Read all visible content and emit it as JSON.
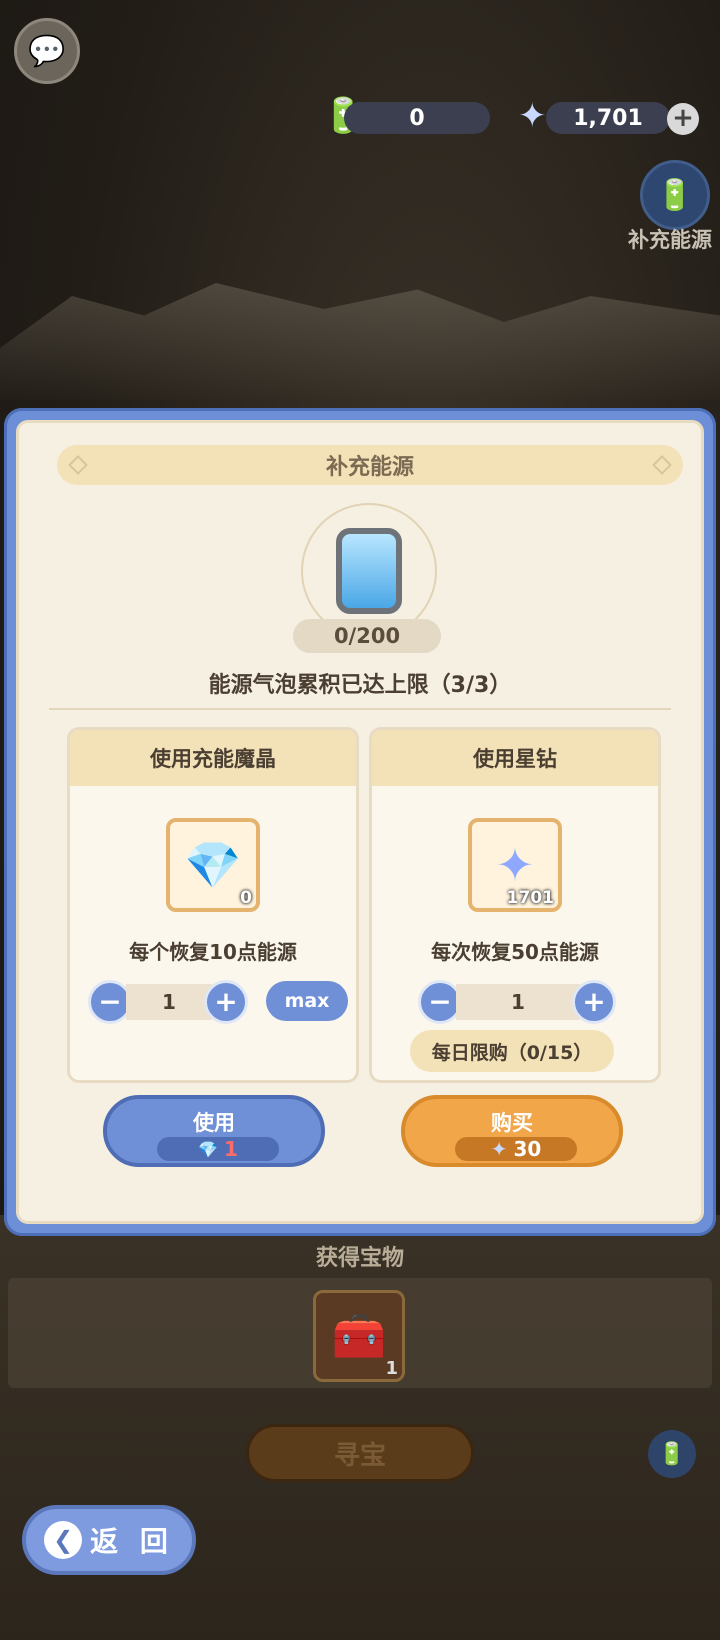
{
  "hud": {
    "energy_capsules": "0",
    "star_diamonds": "1,701",
    "add_icon": "+",
    "side_button_label": "补充能源"
  },
  "dialog": {
    "title": "补充能源",
    "energy_count": "0/200",
    "limit_text": "能源气泡累积已达上限（3/3）",
    "left_card": {
      "header": "使用充能魔晶",
      "item_count": "0",
      "description": "每个恢复10点能源",
      "quantity": "1",
      "max_label": "max"
    },
    "right_card": {
      "header": "使用星钻",
      "item_count": "1701",
      "description": "每次恢复50点能源",
      "quantity": "1",
      "daily_limit": "每日限购（0/15）"
    },
    "use_button": {
      "label": "使用",
      "cost": "1"
    },
    "buy_button": {
      "label": "购买",
      "cost": "30"
    }
  },
  "background": {
    "section_title": "获得宝物",
    "chest_count": "1",
    "seek_button": "寻宝",
    "back_button": "返 回"
  },
  "colors": {
    "accent_blue": "#6f8fd6",
    "accent_orange": "#f1a64a",
    "panel_bg": "#f6f0e2"
  }
}
